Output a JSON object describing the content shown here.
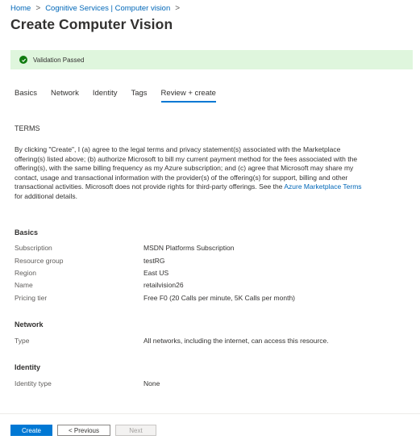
{
  "breadcrumb": {
    "home": "Home",
    "service": "Cognitive Services | Computer vision",
    "sep": ">"
  },
  "page": {
    "title": "Create Computer Vision",
    "more": "···"
  },
  "banner": {
    "message": "Validation Passed"
  },
  "tabs": [
    {
      "label": "Basics"
    },
    {
      "label": "Network"
    },
    {
      "label": "Identity"
    },
    {
      "label": "Tags"
    },
    {
      "label": "Review + create"
    }
  ],
  "terms": {
    "heading": "TERMS",
    "text_before": "By clicking \"Create\", I (a) agree to the legal terms and privacy statement(s) associated with the Marketplace offering(s) listed above; (b) authorize Microsoft to bill my current payment method for the fees associated with the offering(s), with the same billing frequency as my Azure subscription; and (c) agree that Microsoft may share my contact, usage and transactional information with the provider(s) of the offering(s) for support, billing and other transactional activities. Microsoft does not provide rights for third-party offerings. See the ",
    "link": "Azure Marketplace Terms",
    "text_after": " for additional details."
  },
  "basics": {
    "heading": "Basics",
    "rows": [
      {
        "label": "Subscription",
        "value": "MSDN Platforms Subscription"
      },
      {
        "label": "Resource group",
        "value": "testRG"
      },
      {
        "label": "Region",
        "value": "East US"
      },
      {
        "label": "Name",
        "value": "retailvision26"
      },
      {
        "label": "Pricing tier",
        "value": "Free F0 (20 Calls per minute, 5K Calls per month)"
      }
    ]
  },
  "network": {
    "heading": "Network",
    "rows": [
      {
        "label": "Type",
        "value": "All networks, including the internet, can access this resource."
      }
    ]
  },
  "identity": {
    "heading": "Identity",
    "rows": [
      {
        "label": "Identity type",
        "value": "None"
      }
    ]
  },
  "footer": {
    "create": "Create",
    "previous": "< Previous",
    "next": "Next"
  },
  "colors": {
    "accent": "#0078d4",
    "success": "#107c10",
    "banner_bg": "#dff6dd",
    "link": "#0067b8"
  }
}
